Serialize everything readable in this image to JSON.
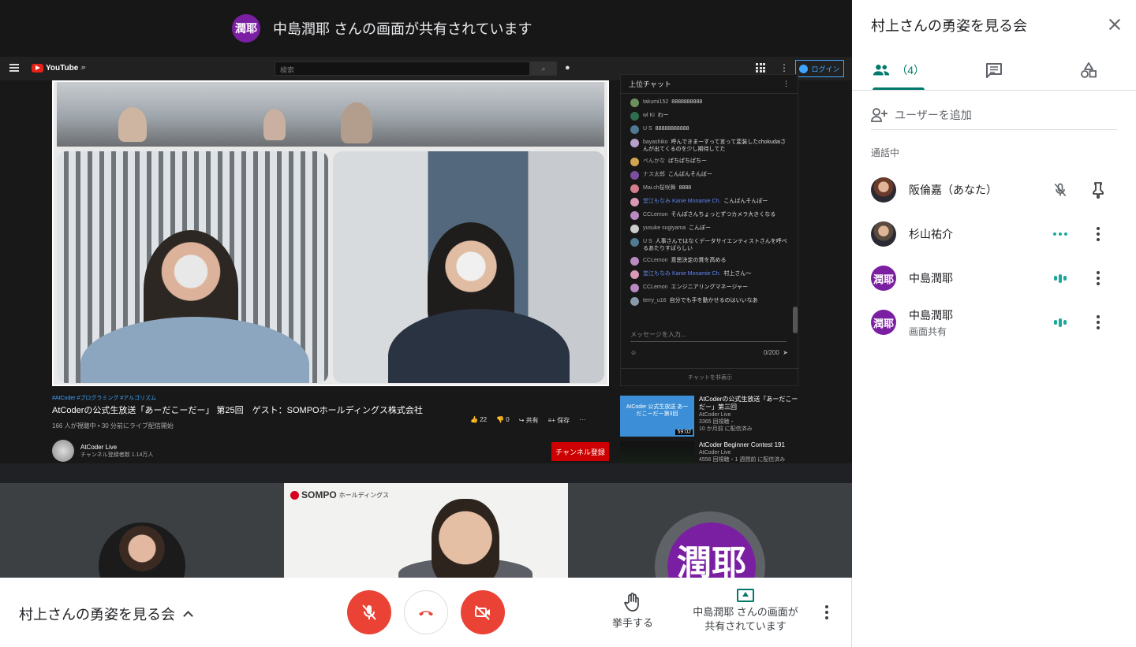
{
  "banner": {
    "avatar": "潤耶",
    "text": "中島潤耶 さんの画面が共有されています"
  },
  "youtube": {
    "logo": "YouTube",
    "logo_sup": "JP",
    "search_placeholder": "検索",
    "login": "ログイン",
    "chat_header": "上位チャット",
    "chat_messages": [
      {
        "name": "takumi152",
        "text": "8888888888",
        "mod": false,
        "color": "#6d8f60"
      },
      {
        "name": "wl Ki",
        "text": "わー",
        "mod": false,
        "color": "#2f6f4f"
      },
      {
        "name": "U S",
        "text": "88888888888",
        "mod": false,
        "color": "#4f7a92"
      },
      {
        "name": "bayashiko",
        "text": "呼んできまーすって言って変装したchokudaiさんが出てくるのを少し期待してた",
        "mod": false,
        "color": "#b7a1c9"
      },
      {
        "name": "ぺんかな",
        "text": "ぱちぱちぱちー",
        "mod": false,
        "color": "#d2a64f"
      },
      {
        "name": "ナス太郎",
        "text": "こんばんそんぼー",
        "mod": false,
        "color": "#7a4fa0"
      },
      {
        "name": "Mai.ch桜咲舞",
        "text": "8888",
        "mod": false,
        "color": "#d37e8e"
      },
      {
        "name": "堂江もなみ Kanie Monamie Ch.",
        "text": "こんばんそんぽー",
        "mod": true,
        "color": "#d799b6"
      },
      {
        "name": "CCLemon",
        "text": "そんぽさんちょっとずつカメラ大きくなる",
        "mod": false,
        "color": "#b88ac0"
      },
      {
        "name": "yusuke sugiyama",
        "text": "こんぽー",
        "mod": false,
        "color": "#cccccc"
      },
      {
        "name": "U S",
        "text": "人事さんではなくデータサイエンティストさんを呼べるあたりすばらしい",
        "mod": false,
        "color": "#4f7a92"
      },
      {
        "name": "CCLemon",
        "text": "意思決定の質を高める",
        "mod": false,
        "color": "#b88ac0"
      },
      {
        "name": "堂江もなみ Kanie Monamie Ch.",
        "text": "村上さん〜",
        "mod": true,
        "color": "#d799b6"
      },
      {
        "name": "CCLemon",
        "text": "エンジニアリングマネージャー",
        "mod": false,
        "color": "#b88ac0"
      },
      {
        "name": "terry_u16",
        "text": "自分でも手を動かせるのはいいなあ",
        "mod": false,
        "color": "#8b9aa8"
      }
    ],
    "chat_input_placeholder": "メッセージを入力...",
    "chat_count": "0/200",
    "chat_hide": "チャットを非表示",
    "tags": "#AtCoder #プログラミング #アルゴリズム",
    "video_title": "AtCoderの公式生放送「あーだこーだー」 第25回　ゲスト：SOMPOホールディングス株式会社",
    "video_meta": "166 人が視聴中 • 30 分前にライブ配信開始",
    "likes": "22",
    "dislikes": "0",
    "share": "共有",
    "save": "保存",
    "channel_name": "AtCoder Live",
    "channel_subs": "チャンネル登録者数 1.14万人",
    "subscribe": "チャンネル登録",
    "related": [
      {
        "title": "AtCoderの公式生放送「あーだこーだー」第三回",
        "channel": "AtCoder Live",
        "meta": "3365 回視聴・",
        "meta2": "10 か月前 に配信済み",
        "duration": "59:02",
        "thumb_text": "AtCoder 公式生放送 あーだこーだー第3回"
      },
      {
        "title": "AtCoder Beginner Contest 191",
        "channel": "AtCoder Live",
        "meta": "4556 回視聴・1 週間前 に配信済み",
        "meta2": "",
        "duration": "",
        "thumb_text": ""
      }
    ]
  },
  "tiles": {
    "speaker_logo": "SOMPO",
    "speaker_logo_sub": "ホールディングス",
    "avatar_text": "潤耶"
  },
  "bottombar": {
    "meeting_title": "村上さんの勇姿を見る会",
    "raise_hand": "挙手する",
    "presenting": "中島潤耶 さんの画面が共有されています"
  },
  "panel": {
    "title": "村上さんの勇姿を見る会",
    "people_count": "（4）",
    "add_user": "ユーザーを追加",
    "section": "通話中",
    "participants": [
      {
        "name": "阪倫嘉（あなた）",
        "sub": "",
        "avatar_text": "",
        "avatar_color": "#6b3a2a",
        "status": "muted",
        "action": "pin"
      },
      {
        "name": "杉山祐介",
        "sub": "",
        "avatar_text": "",
        "avatar_color": "#5b4a3f",
        "status": "dots",
        "action": "more"
      },
      {
        "name": "中島潤耶",
        "sub": "",
        "avatar_text": "潤耶",
        "avatar_color": "#7b1fa2",
        "status": "speaking",
        "action": "more"
      },
      {
        "name": "中島潤耶",
        "sub": "画面共有",
        "avatar_text": "潤耶",
        "avatar_color": "#7b1fa2",
        "status": "speaking",
        "action": "more"
      }
    ]
  },
  "colors": {
    "accent": "#00796b",
    "danger": "#ea4335",
    "avatar_purple": "#7b1fa2",
    "youtube_red": "#cc0000"
  }
}
